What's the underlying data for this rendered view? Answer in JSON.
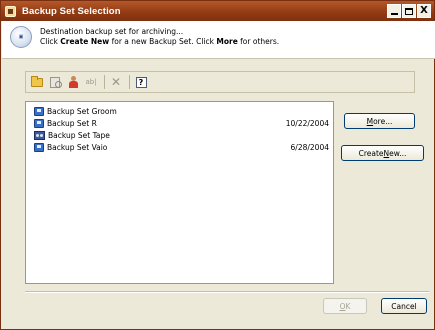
{
  "window": {
    "title": "Backup Set Selection",
    "buttons": {
      "minimize": "minimize",
      "maximize": "maximize",
      "close": "X"
    }
  },
  "header": {
    "line1": "Destination backup set for archiving...",
    "line2_prefix": "Click ",
    "line2_bold1": "Create New",
    "line2_mid": " for a new Backup Set. Click ",
    "line2_bold2": "More",
    "line2_suffix": " for others."
  },
  "toolbar": {
    "icons": [
      "new-folder-icon",
      "properties-icon",
      "user-icon",
      "rename-icon",
      "delete-icon",
      "help-icon"
    ],
    "rename_glyph": "ab|",
    "delete_glyph": "✕",
    "help_glyph": "?"
  },
  "backup_sets": [
    {
      "name": "Backup Set Groom",
      "date": "",
      "icon": "disk"
    },
    {
      "name": "Backup Set R",
      "date": "10/22/2004",
      "icon": "disk"
    },
    {
      "name": "Backup Set Tape",
      "date": "",
      "icon": "tape"
    },
    {
      "name": "Backup Set Vaio",
      "date": "6/28/2004",
      "icon": "disk"
    }
  ],
  "buttons": {
    "more_underlined": "M",
    "more_rest": "ore...",
    "create_prefix": "Create ",
    "create_underlined": "N",
    "create_rest": "ew...",
    "ok_underlined": "O",
    "ok_rest": "K",
    "cancel": "Cancel"
  },
  "colors": {
    "titlebar": "#933c14",
    "window_bg": "#ece9d8",
    "list_border": "#7f9db9"
  }
}
